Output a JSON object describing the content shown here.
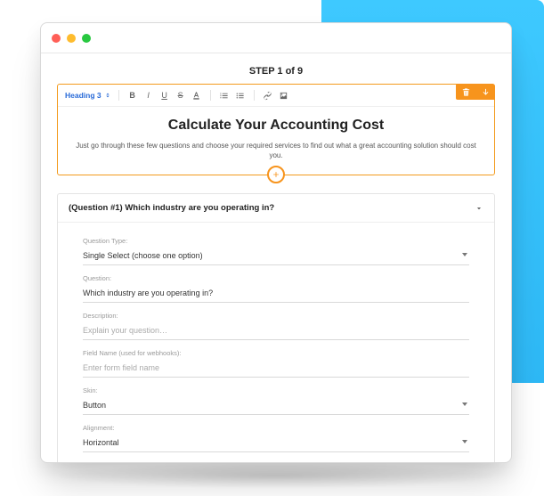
{
  "step_label": "STEP 1 of 9",
  "toolbar": {
    "heading_select": "Heading 3"
  },
  "editor": {
    "title": "Calculate Your Accounting Cost",
    "subtitle": "Just go through these few questions and choose your required services to find out what a great accounting solution should cost you."
  },
  "question": {
    "header": "(Question #1) Which industry are you operating in?",
    "fields": {
      "type": {
        "label": "Question Type:",
        "value": "Single Select (choose one option)"
      },
      "question": {
        "label": "Question:",
        "value": "Which industry are you operating in?"
      },
      "description": {
        "label": "Description:",
        "placeholder": "Explain your question…"
      },
      "fieldname": {
        "label": "Field Name (used for webhooks):",
        "placeholder": "Enter form field name"
      },
      "skin": {
        "label": "Skin:",
        "value": "Button"
      },
      "alignment": {
        "label": "Alignment:",
        "value": "Horizontal"
      }
    }
  }
}
